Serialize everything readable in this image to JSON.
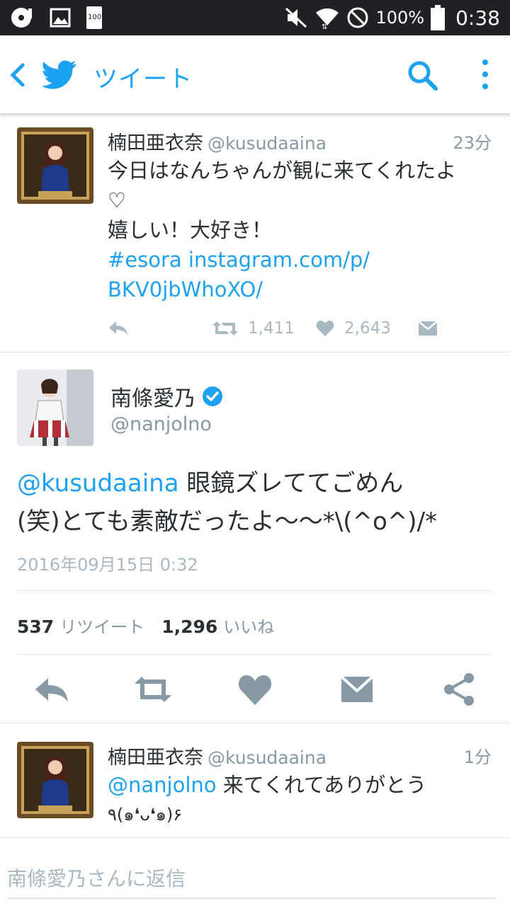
{
  "status_bar": {
    "battery_percent": "100%",
    "time": "0:38",
    "battery_icon_label": "100"
  },
  "app_bar": {
    "title": "ツイート"
  },
  "tweets": [
    {
      "name": "楠田亜衣奈",
      "handle": "@kusudaaina",
      "time": "23分",
      "lines": [
        "今日はなんちゃんが観に来てくれたよ",
        "♡",
        "嬉しい！大好き！"
      ],
      "hashtag": "#esora",
      "link_1": " instagram.com/p/",
      "link_2": "BKV0jbWhoXO/",
      "retweets": "1,411",
      "likes": "2,643"
    },
    {
      "name": "南條愛乃",
      "handle": "@nanjolno",
      "mention": "@kusudaaina",
      "text_1": " 眼鏡ズレててごめん",
      "text_2": "(笑)とても素敵だったよ〜〜*\\(^o^)/*",
      "date": "2016年09月15日 0:32",
      "retweet_count": "537",
      "retweet_label": "リツイート",
      "like_count": "1,296",
      "like_label": "いいね"
    },
    {
      "name": "楠田亜衣奈",
      "handle": "@kusudaaina",
      "time": "1分",
      "mention": "@nanjolno",
      "text_1": " 来てくれてありがとう",
      "text_2": "٩(๑❛ᴗ❛๑)۶"
    }
  ],
  "reply": {
    "placeholder": "南條愛乃さんに返信"
  },
  "colors": {
    "accent": "#1da1f2",
    "muted": "#8899a6",
    "icon": "#aab8c2",
    "verified": "#1da1f2"
  }
}
